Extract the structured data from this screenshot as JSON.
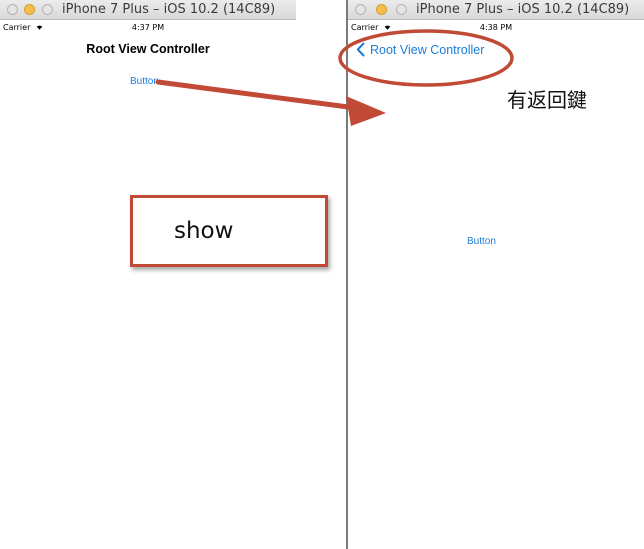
{
  "left_simulator": {
    "window_title": "iPhone 7 Plus – iOS 10.2 (14C89)",
    "status": {
      "carrier": "Carrier",
      "time": "4:37 PM"
    },
    "nav_title": "Root View Controller",
    "button_label": "Button"
  },
  "right_simulator": {
    "window_title": "iPhone 7 Plus – iOS 10.2 (14C89)",
    "status": {
      "carrier": "Carrier",
      "time": "4:38 PM"
    },
    "back_button_label": "Root View Controller",
    "button_label": "Button"
  },
  "annotations": {
    "show_label": "show",
    "back_note": "有返回鍵",
    "accent_color": "#c04a36"
  },
  "colors": {
    "ios_tint": "#1a7dd8",
    "minimize_light": "#f5bd4f"
  },
  "icons": [
    "wifi-icon",
    "chevron-left-icon",
    "close-light-icon",
    "minimize-light-icon",
    "zoom-light-icon",
    "arrow-icon"
  ]
}
